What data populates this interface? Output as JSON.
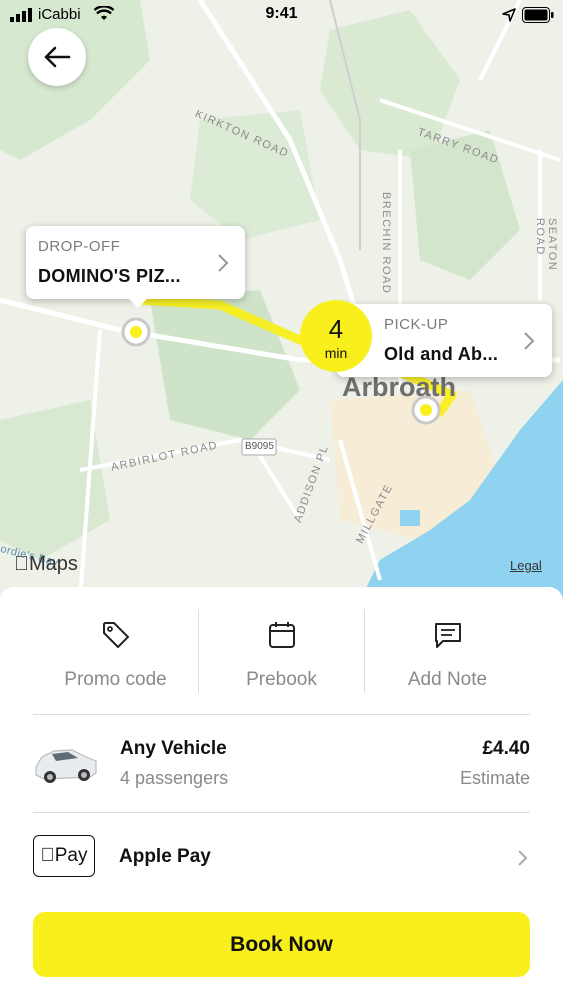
{
  "status_bar": {
    "carrier": "iCabbi",
    "time": "9:41"
  },
  "map": {
    "roads": [
      "KIRKTON ROAD",
      "TARRY ROAD",
      "BRECHIN ROAD",
      "SEATON ROAD",
      "ARBIRLOT ROAD",
      "B9095",
      "ADDISON PL",
      "MILLGATE",
      "ordie's Bay"
    ],
    "town_label": "Arbroath",
    "attribution": "Maps",
    "legal": "Legal",
    "route_color": "#f8ef1c"
  },
  "dropoff": {
    "label": "DROP-OFF",
    "place": "DOMINO'S PIZ..."
  },
  "pickup": {
    "label": "PICK-UP",
    "place": "Old and Ab..."
  },
  "eta": {
    "value": "4",
    "unit": "min"
  },
  "options": [
    {
      "label": "Promo code",
      "icon": "tag-icon"
    },
    {
      "label": "Prebook",
      "icon": "calendar-icon"
    },
    {
      "label": "Add Note",
      "icon": "note-icon"
    }
  ],
  "vehicle": {
    "name": "Any Vehicle",
    "passengers": "4 passengers",
    "price": "£4.40",
    "price_note": "Estimate"
  },
  "payment": {
    "badge": "Pay",
    "method": "Apple Pay"
  },
  "book_button": "Book Now",
  "colors": {
    "accent": "#f8ef1c",
    "map_base": "#eef1e8",
    "water": "#8fd3f0"
  }
}
